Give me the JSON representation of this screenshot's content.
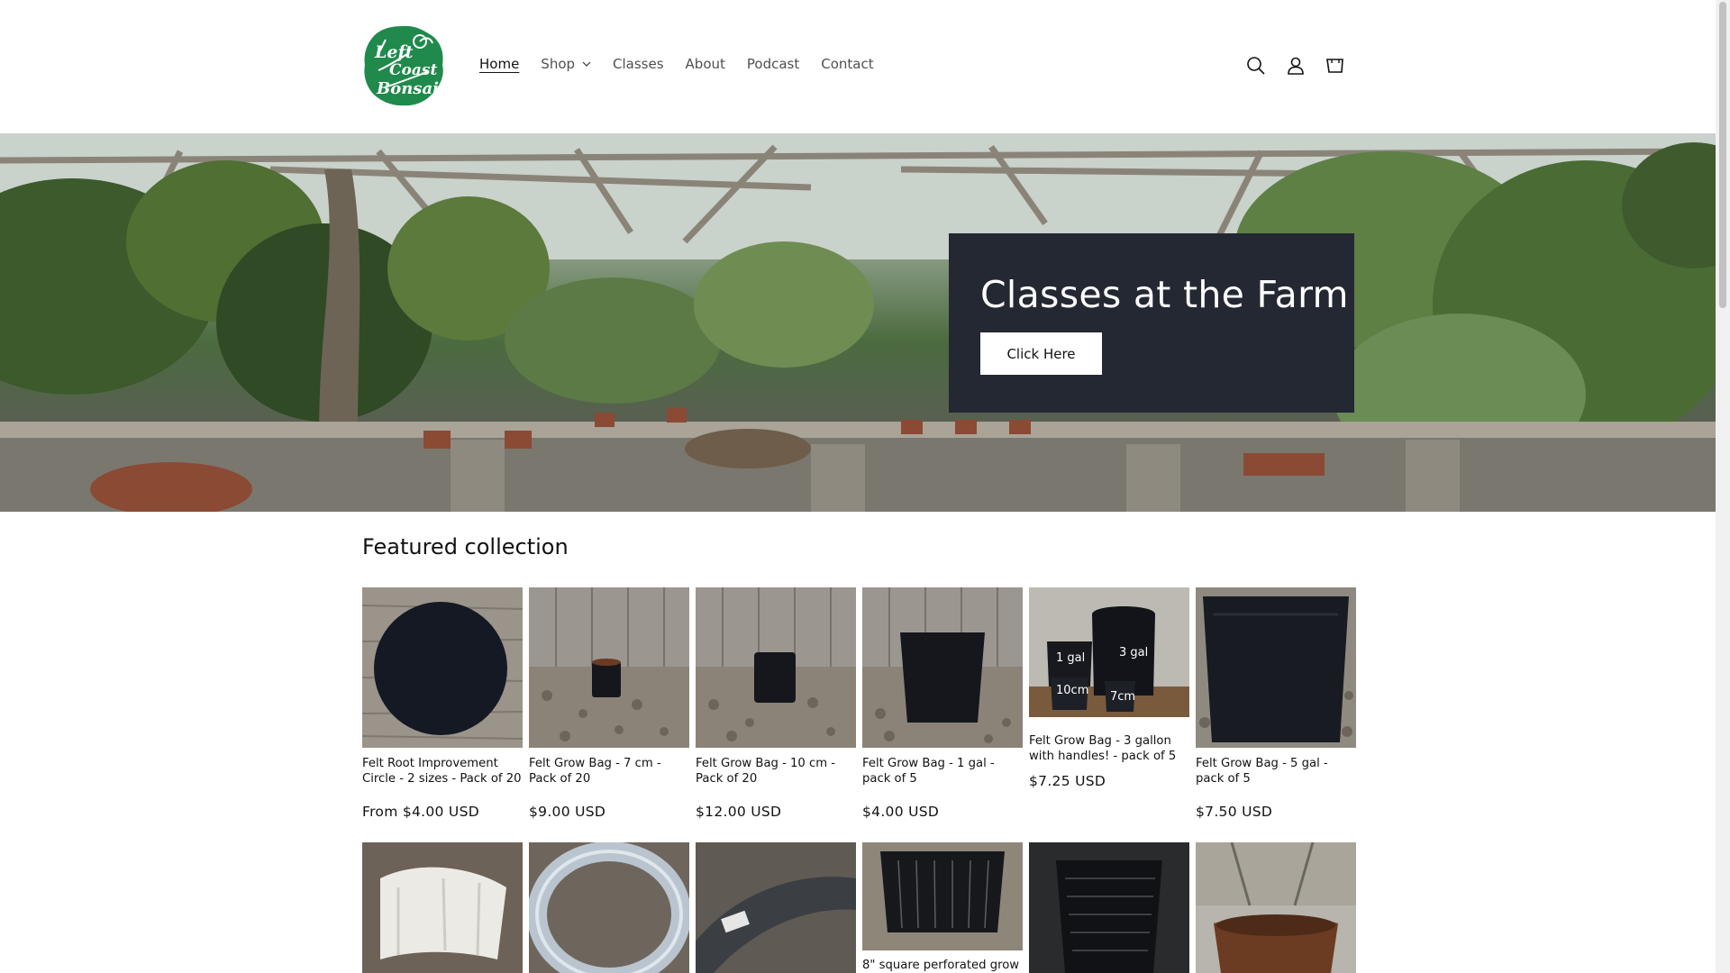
{
  "header": {
    "logo_text": "Left Coast Bonsai",
    "nav": [
      {
        "label": "Home",
        "active": true
      },
      {
        "label": "Shop",
        "dropdown": true
      },
      {
        "label": "Classes"
      },
      {
        "label": "About"
      },
      {
        "label": "Podcast"
      },
      {
        "label": "Contact"
      }
    ],
    "icons": [
      "search-icon",
      "account-icon",
      "cart-icon"
    ]
  },
  "hero": {
    "title": "Classes at the Farm",
    "button_label": "Click Here"
  },
  "featured": {
    "title": "Featured collection",
    "products": [
      {
        "name": "Felt Root Improvement Circle - 2 sizes - Pack of 20",
        "price": "From $4.00 USD"
      },
      {
        "name": "Felt Grow Bag - 7 cm - Pack of 20",
        "price": "$9.00 USD"
      },
      {
        "name": "Felt Grow Bag - 10 cm - Pack of 20",
        "price": "$12.00 USD"
      },
      {
        "name": "Felt Grow Bag - 1 gal - pack of 5",
        "price": "$4.00 USD"
      },
      {
        "name": "Felt Grow Bag - 3 gallon with handles! - pack of 5",
        "price": "$7.25 USD",
        "image_labels": [
          "1 gal",
          "3 gal",
          "10cm",
          "7cm"
        ]
      },
      {
        "name": "Felt Grow Bag - 5 gal - pack of 5",
        "price": "$7.50 USD"
      }
    ],
    "row2_partial_name": "8\" square perforated grow"
  },
  "colors": {
    "hero_box": "#242833",
    "logo_green": "#1f8a4c",
    "text": "#121212"
  }
}
